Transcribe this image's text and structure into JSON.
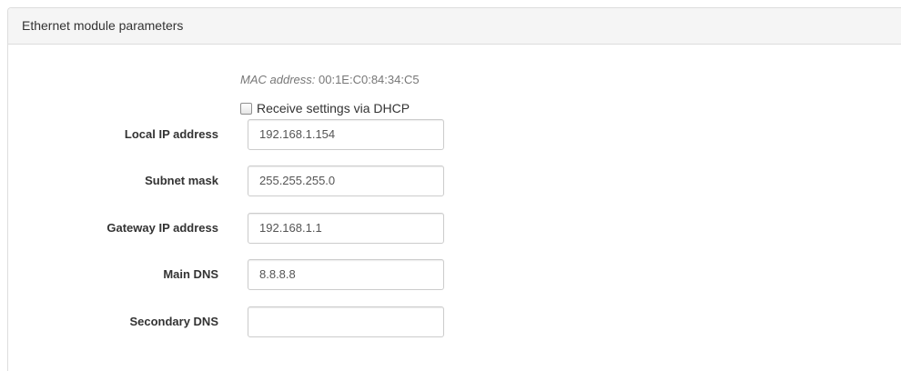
{
  "panel": {
    "title": "Ethernet module parameters"
  },
  "mac": {
    "label": "MAC address:",
    "value": "00:1E:C0:84:34:C5"
  },
  "dhcp": {
    "label": "Receive settings via DHCP",
    "checked": false
  },
  "fields": [
    {
      "label": "Local IP address",
      "value": "192.168.1.154"
    },
    {
      "label": "Subnet mask",
      "value": "255.255.255.0"
    },
    {
      "label": "Gateway IP address",
      "value": "192.168.1.1"
    },
    {
      "label": "Main DNS",
      "value": "8.8.8.8"
    },
    {
      "label": "Secondary DNS",
      "value": ""
    }
  ]
}
